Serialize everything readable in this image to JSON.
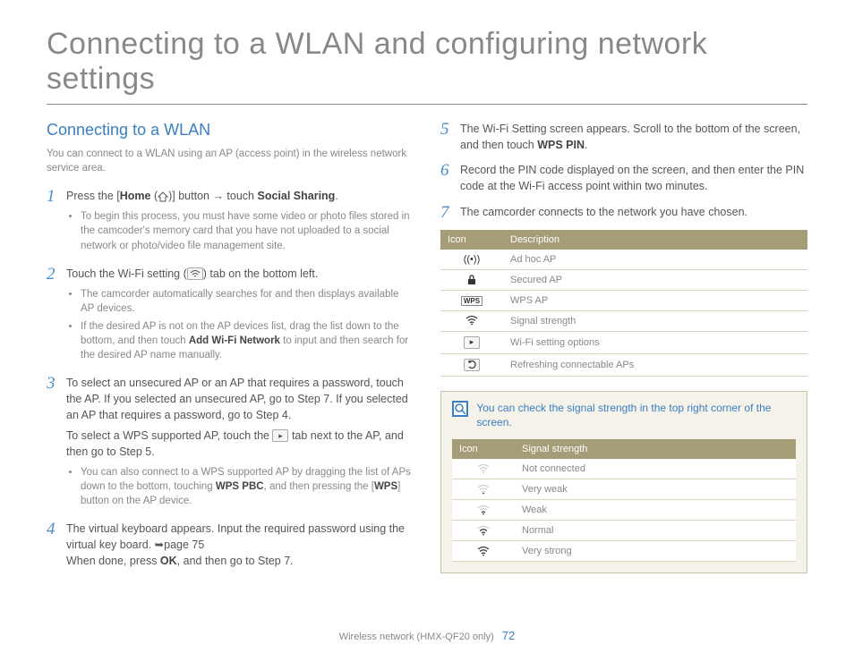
{
  "title": "Connecting to a WLAN and configuring network settings",
  "section_heading": "Connecting to a WLAN",
  "intro": "You can connect to a WLAN using an AP (access point) in the wireless network service area.",
  "steps_left": [
    {
      "num": "1",
      "text_pre": "Press the [",
      "home_label": "Home",
      "text_mid": " (",
      "text_post": ")] button → touch ",
      "social": "Social Sharing",
      "bullets": [
        "To begin this process, you must have some video or photo files stored in the camcoder's memory card that you have not uploaded to a social network or photo/video file management site."
      ]
    },
    {
      "num": "2",
      "text": "Touch the Wi-Fi setting (",
      "text2": ") tab on the bottom left.",
      "bullets": [
        "The camcorder automatically searches for and then displays available AP devices.",
        "If the desired AP is not on the AP devices list, drag the list down to the bottom, and then touch Add Wi-Fi Network to input and then search for the desired AP name manually."
      ],
      "bold_in_bullet": "Add Wi-Fi Network"
    },
    {
      "num": "3",
      "para1": "To select an unsecured AP or an AP that requires a password, touch the AP. If you selected an unsecured AP, go to Step 7. If you selected an AP that requires a password, go to Step 4.",
      "para2_pre": "To select a WPS supported AP, touch the ",
      "para2_post": " tab next to the AP, and then go to Step 5.",
      "bullets_pre": "You can also connect to a WPS supported AP by dragging the list of APs down to the bottom, touching ",
      "wps_pbc": "WPS PBC",
      "bullets_mid": ", and then pressing the [",
      "wps": "WPS",
      "bullets_post": "] button on the AP device."
    },
    {
      "num": "4",
      "para1": "The virtual keyboard appears. Input the required password using the virtual key board. ➥page 75",
      "para2_pre": "When done, press ",
      "ok": "OK",
      "para2_post": ", and then go to Step 7."
    }
  ],
  "steps_right": [
    {
      "num": "5",
      "pre": "The Wi-Fi Setting screen appears. Scroll to the bottom of the screen, and then touch ",
      "bold": "WPS PIN",
      "post": "."
    },
    {
      "num": "6",
      "text": "Record the PIN code displayed on the screen, and then enter the PIN code at the Wi-Fi access point within two minutes."
    },
    {
      "num": "7",
      "text": "The camcorder connects to the network you have chosen."
    }
  ],
  "table1": {
    "h1": "Icon",
    "h2": "Description",
    "rows": [
      {
        "desc": "Ad hoc AP"
      },
      {
        "desc": "Secured AP"
      },
      {
        "desc": "WPS AP"
      },
      {
        "desc": "Signal strength"
      },
      {
        "desc": "Wi-Fi setting options"
      },
      {
        "desc": "Refreshing connectable APs"
      }
    ]
  },
  "note": "You can check the signal strength in the top right corner of the screen.",
  "table2": {
    "h1": "Icon",
    "h2": "Signal strength",
    "rows": [
      {
        "desc": "Not connected"
      },
      {
        "desc": "Very weak"
      },
      {
        "desc": "Weak"
      },
      {
        "desc": "Normal"
      },
      {
        "desc": "Very strong"
      }
    ]
  },
  "footer_label": "Wireless network (HMX-QF20 only)",
  "page_num": "72"
}
